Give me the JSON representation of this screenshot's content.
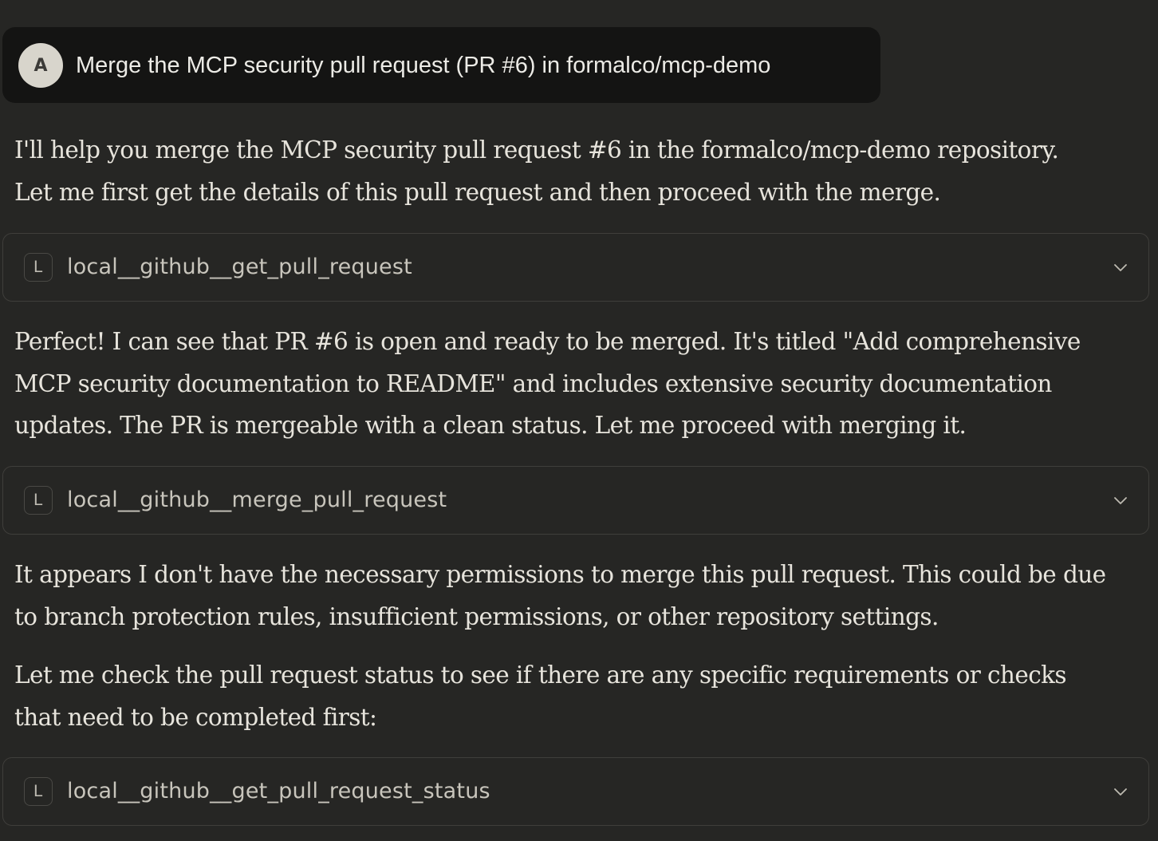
{
  "user_message": {
    "avatar_initial": "A",
    "text": "Merge the MCP security pull request (PR #6) in formalco/mcp-demo"
  },
  "messages": [
    {
      "lines": [
        "I'll help you merge the MCP security pull request #6 in the formalco/mcp-demo repository.",
        "Let me first get the details of this pull request and then proceed with the merge."
      ]
    },
    {
      "lines": [
        "Perfect! I can see that PR #6 is open and ready to be merged. It's titled \"Add comprehensive",
        "MCP security documentation to README\" and includes extensive security documentation",
        "updates. The PR is mergeable with a clean status. Let me proceed with merging it."
      ]
    },
    {
      "lines": [
        "It appears I don't have the necessary permissions to merge this pull request. This could be due",
        "to branch protection rules, insufficient permissions, or other repository settings."
      ]
    },
    {
      "lines": [
        "Let me check the pull request status to see if there are any specific requirements or checks",
        "that need to be completed first:"
      ]
    }
  ],
  "tool_calls": [
    {
      "badge": "L",
      "name": "local__github__get_pull_request",
      "icon": "chevron-down-icon"
    },
    {
      "badge": "L",
      "name": "local__github__merge_pull_request",
      "icon": "chevron-down-icon"
    },
    {
      "badge": "L",
      "name": "local__github__get_pull_request_status",
      "icon": "chevron-down-icon"
    }
  ],
  "colors": {
    "background": "#262624",
    "user_bubble": "#141413",
    "text": "#e7e4dc",
    "border": "#3f3e3b"
  }
}
